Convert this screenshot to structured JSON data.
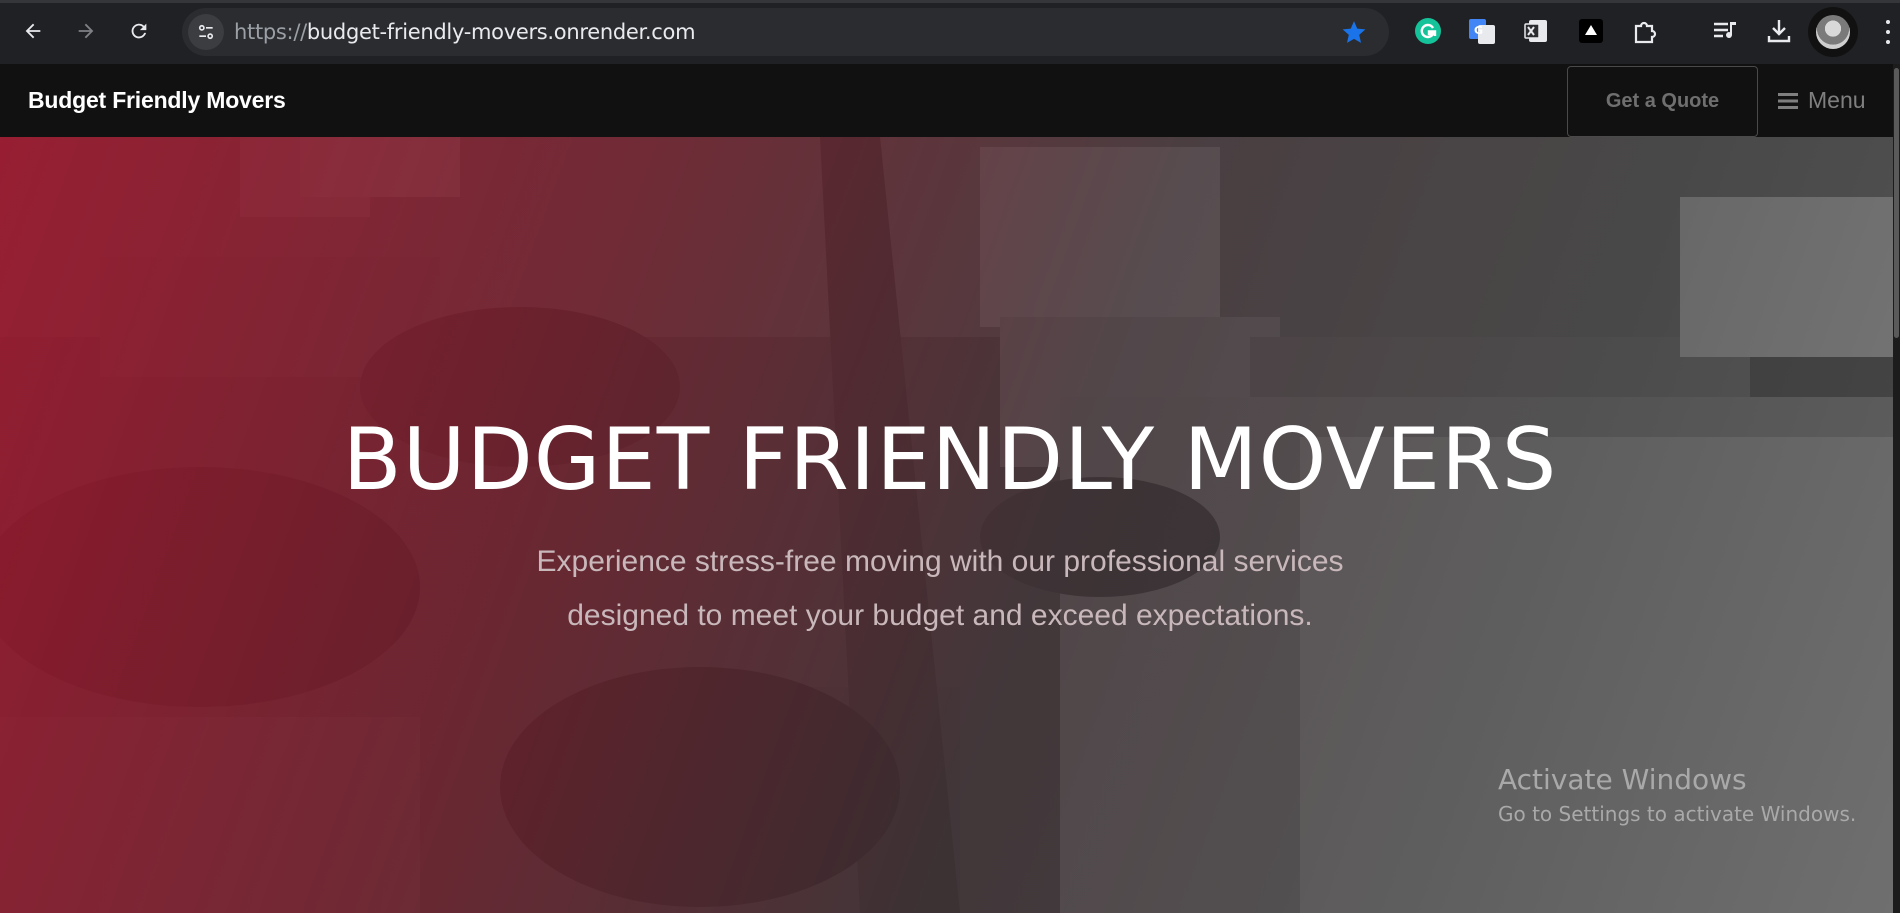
{
  "browser": {
    "url_scheme": "https://",
    "url_host": "budget-friendly-movers.onrender.com",
    "extensions": [
      "grammarly-icon",
      "google-translate-icon",
      "excel-extension-icon",
      "drive-extension-icon",
      "puzzle-extensions-icon",
      "reading-list-icon",
      "download-icon"
    ]
  },
  "site": {
    "brand": "Budget Friendly Movers",
    "quote_button": "Get a Quote",
    "menu_button": "Menu"
  },
  "hero": {
    "title": "BUDGET FRIENDLY MOVERS",
    "subtitle_line1": "Experience stress-free moving with our professional services",
    "subtitle_line2": "designed to meet your budget and exceed expectations."
  },
  "watermark": {
    "title": "Activate Windows",
    "subtitle": "Go to Settings to activate Windows."
  },
  "colors": {
    "accent_red": "#a0162d",
    "star_blue": "#1a73e8",
    "nav_bg": "#111111"
  }
}
